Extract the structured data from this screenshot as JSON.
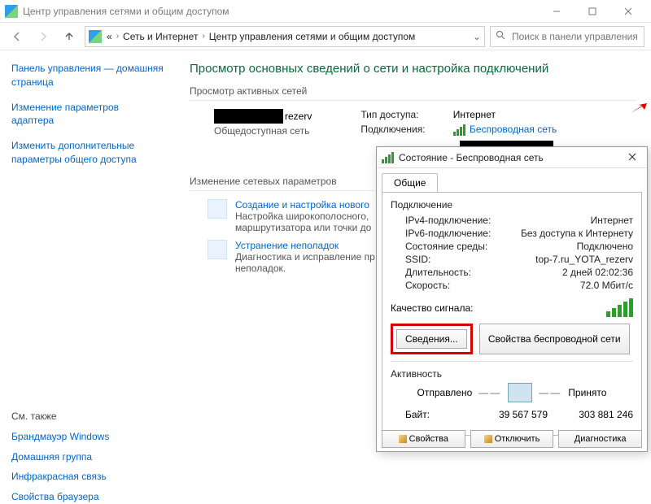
{
  "window": {
    "title": "Центр управления сетями и общим доступом"
  },
  "breadcrumb": {
    "root_glyph": "«",
    "item1": "Сеть и Интернет",
    "item2": "Центр управления сетями и общим доступом"
  },
  "search": {
    "placeholder": "Поиск в панели управления"
  },
  "sidebar": {
    "links": [
      "Панель управления — домашняя страница",
      "Изменение параметров адаптера",
      "Изменить дополнительные параметры общего доступа"
    ],
    "see_also_title": "См. также",
    "see_also": [
      "Брандмауэр Windows",
      "Домашняя группа",
      "Инфракрасная связь",
      "Свойства браузера"
    ]
  },
  "page": {
    "title": "Просмотр основных сведений о сети и настройка подключений",
    "active_networks_hdr": "Просмотр активных сетей",
    "network_name_suffix": "rezerv",
    "network_category": "Общедоступная сеть",
    "access_type_lbl": "Тип доступа:",
    "access_type_val": "Интернет",
    "connections_lbl": "Подключения:",
    "connections_link": "Беспроводная сеть",
    "change_settings_hdr": "Изменение сетевых параметров",
    "task1_title": "Создание и настройка нового",
    "task1_desc": "Настройка широкополосного, маршрутизатора или точки до",
    "task2_title": "Устранение неполадок",
    "task2_desc": "Диагностика и исправление пр неполадок."
  },
  "dialog": {
    "title": "Состояние - Беспроводная сеть",
    "tab_general": "Общие",
    "group_connection": "Подключение",
    "ipv4_lbl": "IPv4-подключение:",
    "ipv4_val": "Интернет",
    "ipv6_lbl": "IPv6-подключение:",
    "ipv6_val": "Без доступа к Интернету",
    "media_lbl": "Состояние среды:",
    "media_val": "Подключено",
    "ssid_lbl": "SSID:",
    "ssid_val": "top-7.ru_YOTA_rezerv",
    "duration_lbl": "Длительность:",
    "duration_val": "2 дней 02:02:36",
    "speed_lbl": "Скорость:",
    "speed_val": "72.0 Мбит/с",
    "signal_lbl": "Качество сигнала:",
    "btn_details": "Сведения...",
    "btn_wifi_props": "Свойства беспроводной сети",
    "group_activity": "Активность",
    "sent_lbl": "Отправлено",
    "recv_lbl": "Принято",
    "bytes_lbl": "Байт:",
    "bytes_sent": "39 567 579",
    "bytes_recv": "303 881 246",
    "btn_properties": "Свойства",
    "btn_disable": "Отключить",
    "btn_diagnose": "Диагностика"
  }
}
